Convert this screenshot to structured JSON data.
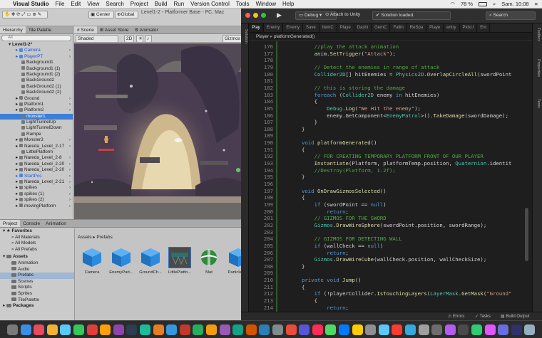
{
  "menubar": {
    "app": "Visual Studio",
    "items": [
      "File",
      "Edit",
      "View",
      "Search",
      "Project",
      "Build",
      "Run",
      "Version Control",
      "Tools",
      "Window",
      "Help"
    ],
    "battery": "78 %",
    "clock": "Sam. 10:08"
  },
  "unity": {
    "title": "Level1-2 - Platformer Base - PC, Mac",
    "toolbar": {
      "center": "Center",
      "global": "Global"
    },
    "hierarchy": {
      "tabs": [
        "Hierarchy",
        "Tile Palette"
      ],
      "search_placeholder": "All",
      "scene_root": "Level1-2*",
      "items": [
        {
          "label": "Camera",
          "blue": true,
          "arrow": true
        },
        {
          "label": "PlayerPT",
          "blue": true,
          "arrow": true
        },
        {
          "label": "Background1"
        },
        {
          "label": "Background1 (1)"
        },
        {
          "label": "Background1 (2)"
        },
        {
          "label": "BackGround2"
        },
        {
          "label": "BackGround2 (1)"
        },
        {
          "label": "BackGround2 (2)"
        },
        {
          "label": "Ground",
          "arrow": true
        },
        {
          "label": "Platform1",
          "arrow": true
        },
        {
          "label": "Platform2",
          "arrow": true
        },
        {
          "label": "monster1",
          "selected": true
        },
        {
          "label": "LightTunnelUp"
        },
        {
          "label": "LightTunnelDown"
        },
        {
          "label": "Rampe"
        },
        {
          "label": "Monster3",
          "arrow": true
        },
        {
          "label": "Nareda_Level_2-17",
          "arrow": true
        },
        {
          "label": "LittlePlatform"
        },
        {
          "label": "Nareda_Level_2-8",
          "arrow": true
        },
        {
          "label": "Nareda_Level_2-20",
          "arrow": true
        },
        {
          "label": "Nareda_Level_2-20",
          "arrow": true
        },
        {
          "label": "StartPos",
          "blue": true,
          "arrow": true
        },
        {
          "label": "Nareda_Level_2-21",
          "arrow": true
        },
        {
          "label": "spikes",
          "arrow": true
        },
        {
          "label": "spikes (1)",
          "arrow": true
        },
        {
          "label": "spikes (2)",
          "arrow": true
        },
        {
          "label": "movingPlatform",
          "arrow": true
        }
      ]
    },
    "scene": {
      "tabs": [
        "Scene",
        "Asset Store",
        "Animator"
      ],
      "shading": "Shaded",
      "mode": "2D",
      "gizmos": "Gizmos"
    },
    "project": {
      "tabs": [
        "Project",
        "Console",
        "Animation"
      ],
      "favorites": {
        "title": "Favorites",
        "items": [
          "All Materials",
          "All Models",
          "All Prefabs"
        ]
      },
      "assets": {
        "title": "Assets",
        "items": [
          "Animation",
          "Audio",
          "Prefabs",
          "Scenes",
          "Scripts",
          "Sprites",
          "TilePalette"
        ]
      },
      "packages": "Packages",
      "breadcrumb": "Assets ▸ Prefabs",
      "grid": [
        {
          "label": "Camera",
          "kind": "cube"
        },
        {
          "label": "EnemyPart...",
          "kind": "cube"
        },
        {
          "label": "GroundCh...",
          "kind": "cube"
        },
        {
          "label": "LittlePlatfo...",
          "kind": "platform"
        },
        {
          "label": "Mat",
          "kind": "ball"
        },
        {
          "label": "Particle-T...",
          "kind": "cube"
        }
      ]
    }
  },
  "editor": {
    "config": "Debug",
    "attach": "Attach to Unity",
    "status": "Solution loaded.",
    "search_placeholder": "Search",
    "file_tabs": [
      "Play",
      "Enemy",
      "Enemy",
      "Save",
      "ItemC",
      "Playe",
      "Dashi",
      "GemC",
      "Fallin",
      "ReSpa",
      "Playe",
      "entry",
      "PickU",
      "Ent"
    ],
    "breadcrumb": {
      "class": "Player",
      "method": "platformGenerated()"
    },
    "sidebars": {
      "left": "Solution",
      "right": [
        "Toolbox",
        "Properties",
        "Tests"
      ]
    },
    "lines": [
      {
        "n": "176",
        "t": "    //play the attack animation"
      },
      {
        "n": "177",
        "t": "    anim.SetTrigger(\"Attack\");"
      },
      {
        "n": "178",
        "t": ""
      },
      {
        "n": "179",
        "t": "    // Detect the enemies in range of attack"
      },
      {
        "n": "180",
        "t": "    Collider2D[] hitEnemies = Physics2D.OverlapCircleAll(swordPoint"
      },
      {
        "n": "181",
        "t": ""
      },
      {
        "n": "182",
        "t": "    // this is storing the damage"
      },
      {
        "n": "183",
        "t": "    foreach (Collider2D enemy in hitEnemies)"
      },
      {
        "n": "184",
        "t": "    {"
      },
      {
        "n": "185",
        "t": "        Debug.Log(\"We Hit the enemy\");"
      },
      {
        "n": "186",
        "t": "        enemy.GetComponent<EnemyPatrol>().TakeDamage(swordDamage);"
      },
      {
        "n": "187",
        "t": "    }"
      },
      {
        "n": "188",
        "t": "}"
      },
      {
        "n": "189",
        "t": ""
      },
      {
        "n": "190",
        "t": "void platformGenerated()"
      },
      {
        "n": "191",
        "t": "{"
      },
      {
        "n": "192",
        "t": "    // FOR CREATING TEMPORARY PLATFORM FRONT OF OUR PLAYER"
      },
      {
        "n": "193",
        "t": "    Instantiate(Platform, platformTemp.position, Quaternion.identit"
      },
      {
        "n": "194",
        "t": "    //Destroy(Platform, 1.2f);"
      },
      {
        "n": "195",
        "t": "}"
      },
      {
        "n": "196",
        "t": ""
      },
      {
        "n": "197",
        "t": "void OnDrawGizmosSelected()"
      },
      {
        "n": "198",
        "t": "{"
      },
      {
        "n": "199",
        "t": "    if (swordPoint == null)"
      },
      {
        "n": "200",
        "t": "        return;"
      },
      {
        "n": "201",
        "t": "    // GIZMOS FOR THE SWORD"
      },
      {
        "n": "202",
        "t": "    Gizmos.DrawWireSphere(swordPoint.position, swordRange);"
      },
      {
        "n": "203",
        "t": ""
      },
      {
        "n": "204",
        "t": "    // GIZMOS FOR DETECTING WALL"
      },
      {
        "n": "205",
        "t": "    if (wallCheck == null)"
      },
      {
        "n": "206",
        "t": "        return;"
      },
      {
        "n": "207",
        "t": "    Gizmos.DrawWireCube(wallCheck.position, wallCheckSize);"
      },
      {
        "n": "208",
        "t": "}"
      },
      {
        "n": "209",
        "t": ""
      },
      {
        "n": "210",
        "t": "private void Jump()"
      },
      {
        "n": "211",
        "t": "{"
      },
      {
        "n": "212",
        "t": "    if (!playerCollider.IsTouchingLayers(LayerMask.GetMask(\"Ground\""
      },
      {
        "n": "213",
        "t": "    {"
      },
      {
        "n": "214",
        "t": "        return;"
      }
    ],
    "statusbar": {
      "errors": "Errors",
      "tasks": "Tasks",
      "build": "Build Output"
    }
  }
}
